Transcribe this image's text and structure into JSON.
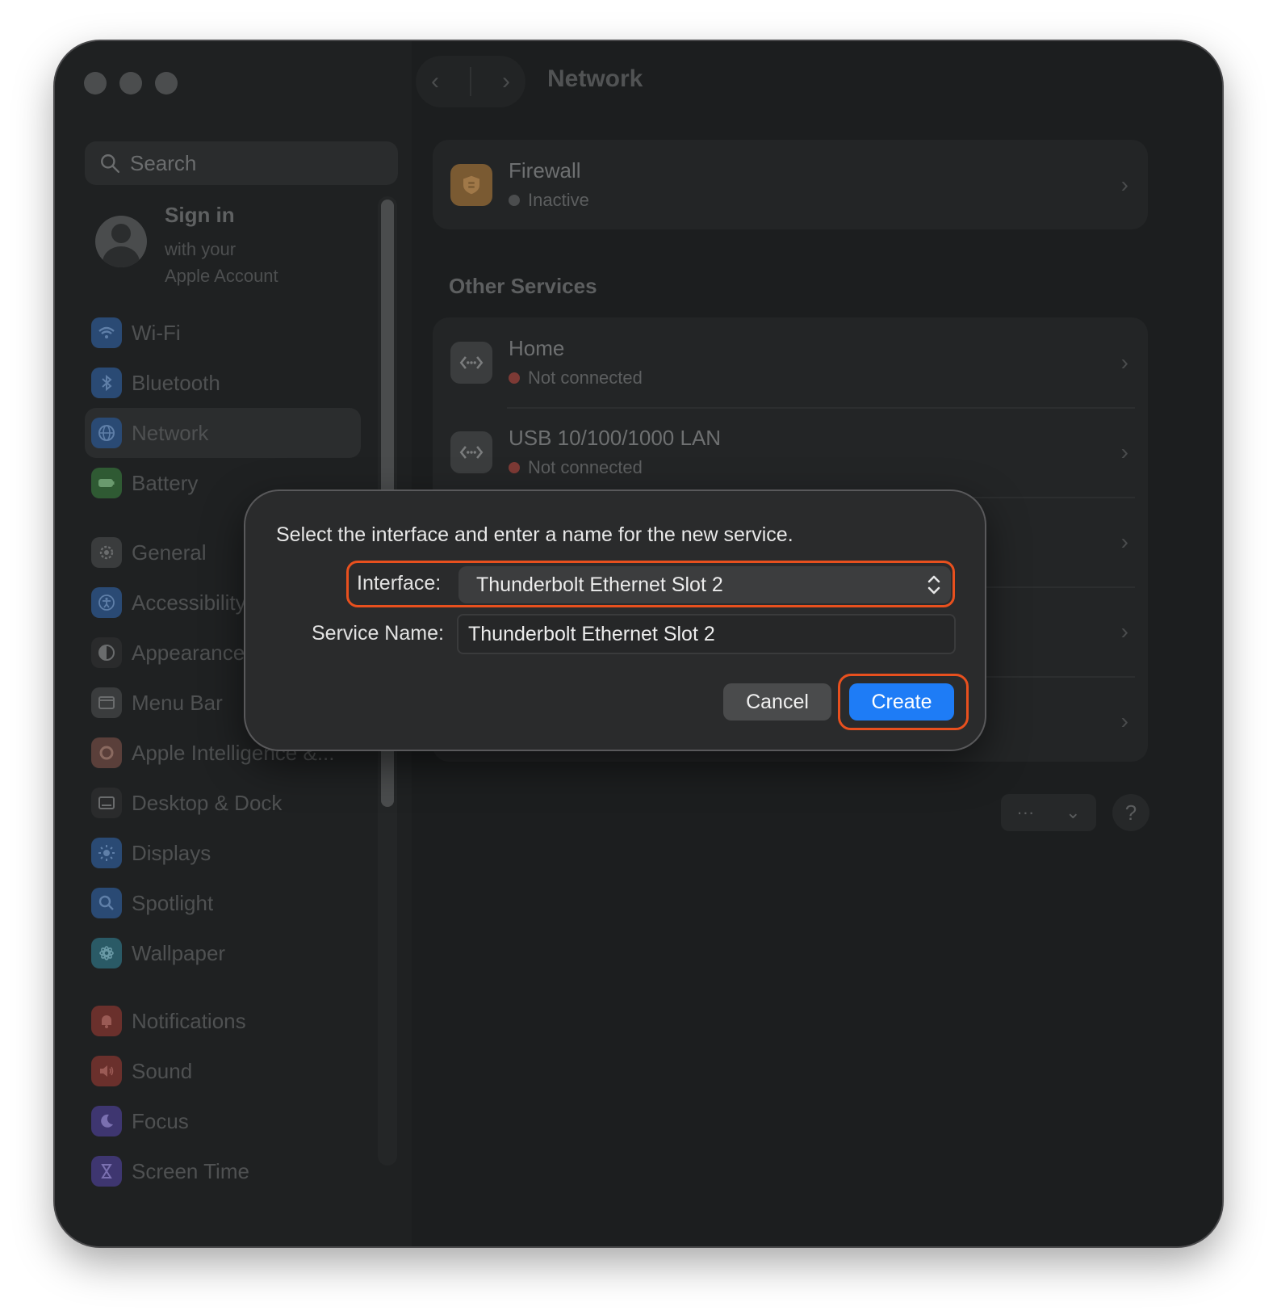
{
  "sidebar": {
    "search_placeholder": "Search",
    "account": {
      "title": "Sign in",
      "line1": "with your",
      "line2": "Apple Account"
    },
    "items": [
      {
        "label": "Wi-Fi",
        "icon": "wifi-icon",
        "color": "#2a4a74"
      },
      {
        "label": "Bluetooth",
        "icon": "bluetooth-icon",
        "color": "#2a4a74"
      },
      {
        "label": "Network",
        "icon": "globe-icon",
        "color": "#2a4a74"
      },
      {
        "label": "Battery",
        "icon": "battery-icon",
        "color": "#2f5a33"
      },
      {
        "label": "General",
        "icon": "gear-icon",
        "color": "#3a3c3d"
      },
      {
        "label": "Accessibility",
        "icon": "accessibility-icon",
        "color": "#2a4a74"
      },
      {
        "label": "Appearance",
        "icon": "appearance-icon",
        "color": "#2a2b2c"
      },
      {
        "label": "Menu Bar",
        "icon": "menubar-icon",
        "color": "#3a3c3d"
      },
      {
        "label": "Apple Intelligence &...",
        "icon": "apple-intelligence-icon",
        "color": "#5a3f3a"
      },
      {
        "label": "Desktop & Dock",
        "icon": "dock-icon",
        "color": "#2a2b2c"
      },
      {
        "label": "Displays",
        "icon": "sun-icon",
        "color": "#2a4a74"
      },
      {
        "label": "Spotlight",
        "icon": "spotlight-icon",
        "color": "#2a4a74"
      },
      {
        "label": "Wallpaper",
        "icon": "wallpaper-icon",
        "color": "#2a5a66"
      },
      {
        "label": "Notifications",
        "icon": "bell-icon",
        "color": "#6a302c"
      },
      {
        "label": "Sound",
        "icon": "speaker-icon",
        "color": "#6a302c"
      },
      {
        "label": "Focus",
        "icon": "moon-icon",
        "color": "#3e3670"
      },
      {
        "label": "Screen Time",
        "icon": "hourglass-icon",
        "color": "#3e3670"
      }
    ]
  },
  "content": {
    "title": "Network",
    "firewall": {
      "title": "Firewall",
      "status": "Inactive"
    },
    "section_title": "Other Services",
    "services": [
      {
        "title": "Home",
        "status": "Not connected"
      },
      {
        "title": "USB 10/100/1000 LAN",
        "status": "Not connected"
      }
    ],
    "more_label": "···",
    "help_label": "?"
  },
  "dialog": {
    "message": "Select the interface and enter a name for the new service.",
    "interface_label": "Interface:",
    "interface_value": "Thunderbolt Ethernet Slot 2",
    "service_name_label": "Service Name:",
    "service_name_value": "Thunderbolt Ethernet Slot 2",
    "cancel_label": "Cancel",
    "create_label": "Create"
  },
  "colors": {
    "accent": "#1e7cf6",
    "highlight": "#e8501e",
    "window_bg": "#1c1e1f"
  }
}
